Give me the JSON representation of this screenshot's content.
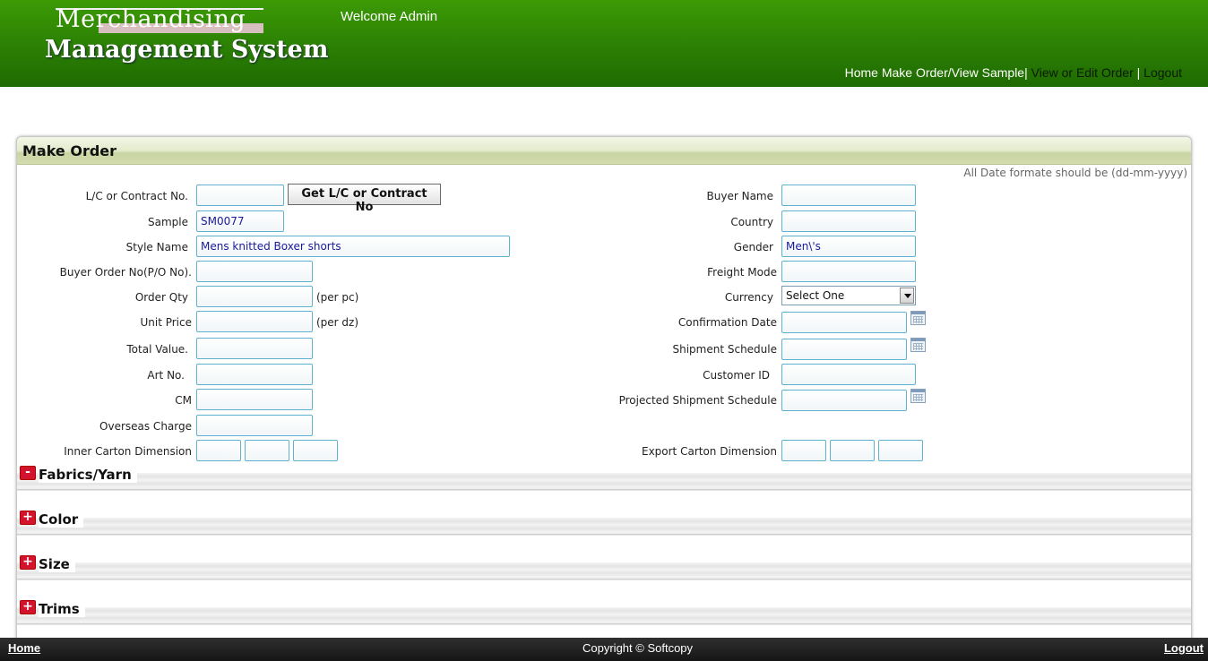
{
  "header": {
    "logo_top": "Merchandising",
    "logo_bottom": "Management System",
    "welcome": "Welcome Admin",
    "nav": {
      "home": "Home",
      "make_order": "Make Order/View Sample",
      "sep1": "|",
      "view_edit": "View or Edit Order",
      "sep2": "|",
      "logout": "Logout"
    }
  },
  "panel": {
    "title": "Make Order",
    "date_note": "All Date formate should be (dd-mm-yyyy)"
  },
  "form": {
    "lc_label": "L/C or Contract No.",
    "lc_value": "",
    "get_lc_button": "Get L/C or Contract No",
    "sample_label": "Sample",
    "sample_value": "SM0077",
    "style_label": "Style Name",
    "style_value": "Mens knitted Boxer shorts",
    "buyer_order_label": "Buyer Order No(P/O No).",
    "order_qty_label": "Order Qty",
    "order_qty_unit": "(per pc)",
    "unit_price_label": "Unit Price",
    "unit_price_unit": "(per dz)",
    "total_value_label": "Total Value.",
    "art_no_label": "Art No.",
    "cm_label": "CM",
    "overseas_label": "Overseas Charge",
    "inner_carton_label": "Inner Carton Dimension",
    "buyer_name_label": "Buyer Name",
    "country_label": "Country",
    "gender_label": "Gender",
    "gender_value": "Men\\'s",
    "freight_label": "Freight Mode",
    "currency_label": "Currency",
    "currency_value": "Select One",
    "confirmation_label": "Confirmation Date",
    "shipment_label": "Shipment Schedule",
    "customer_label": "Customer ID",
    "projected_label": "Projected Shipment Schedule",
    "export_carton_label": "Export Carton Dimension"
  },
  "sections": [
    {
      "toggle": "-",
      "title": "Fabrics/Yarn"
    },
    {
      "toggle": "+",
      "title": "Color"
    },
    {
      "toggle": "+",
      "title": "Size"
    },
    {
      "toggle": "+",
      "title": "Trims"
    }
  ],
  "footer": {
    "home": "Home",
    "copyright": "Copyright © Softcopy",
    "logout": "Logout"
  },
  "colors": {
    "header_green": "#2f8704",
    "input_border": "#5fb2cf",
    "toggle_red": "#d3122d"
  }
}
